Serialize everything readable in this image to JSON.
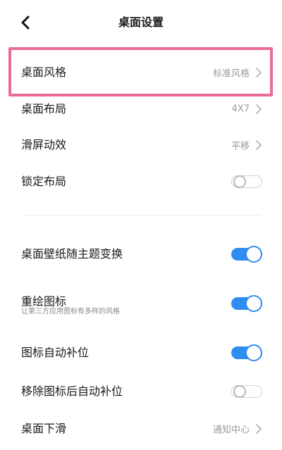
{
  "header": {
    "title": "桌面设置"
  },
  "rows": [
    {
      "label": "桌面风格",
      "value": "标准风格"
    },
    {
      "label": "桌面布局",
      "value": "4X7"
    },
    {
      "label": "滑屏动效",
      "value": "平移"
    },
    {
      "label": "锁定布局",
      "toggle": "off"
    },
    {
      "label": "桌面壁纸随主题变换",
      "toggle": "on"
    },
    {
      "label": "重绘图标",
      "subtitle": "让第三方应用图标有多样的风格",
      "toggle": "on"
    },
    {
      "label": "图标自动补位",
      "toggle": "on"
    },
    {
      "label": "移除图标后自动补位",
      "toggle": "off"
    },
    {
      "label": "桌面下滑",
      "value": "通知中心"
    }
  ],
  "colors": {
    "toggle_on": "#2f8cf0",
    "highlight": "#ec6a97"
  },
  "icons": {
    "back": "back-arrow-icon",
    "chevron": "chevron-right-icon"
  }
}
